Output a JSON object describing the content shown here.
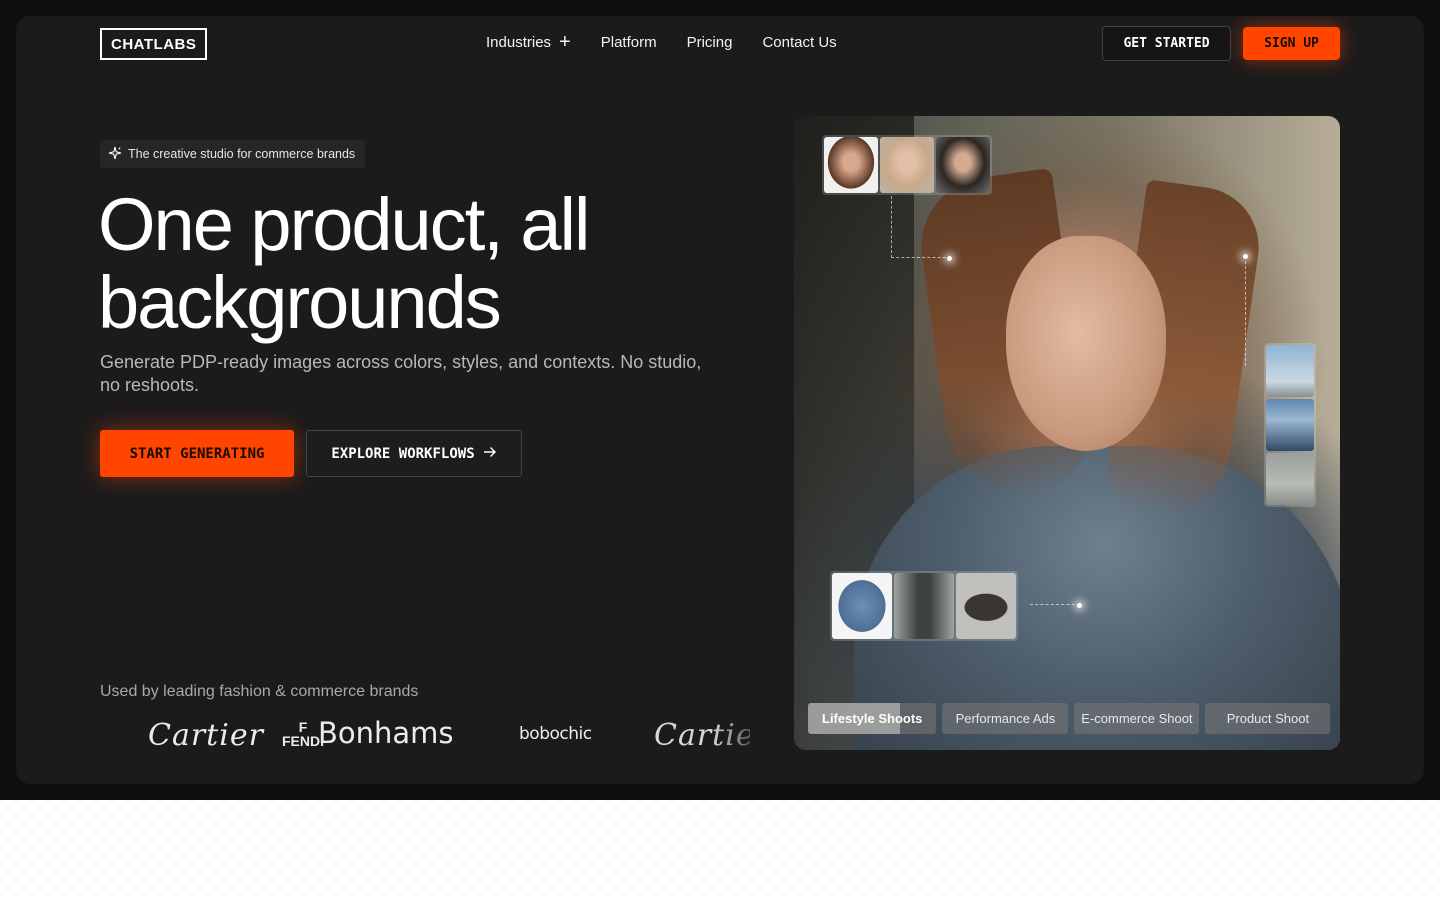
{
  "header": {
    "logo": "CHATLABS",
    "nav": [
      {
        "label": "Industries",
        "has_plus": true
      },
      {
        "label": "Platform"
      },
      {
        "label": "Pricing"
      },
      {
        "label": "Contact Us"
      }
    ],
    "get_started_label": "GET STARTED",
    "sign_up_label": "SIGN UP"
  },
  "hero": {
    "badge": "The creative studio for commerce brands",
    "headline_line1": "One product, all",
    "headline_line2": "backgrounds",
    "subtitle": "Generate PDP-ready images across colors, styles, and contexts. No studio, no reshoots.",
    "cta_primary": "START GENERATING",
    "cta_secondary": "EXPLORE WORKFLOWS",
    "tabs": [
      "Lifestyle Shoots",
      "Performance Ads",
      "E-commerce Shoot",
      "Product Shoot"
    ],
    "active_tab": "Lifestyle Shoots"
  },
  "brands": {
    "caption": "Used by leading fashion & commerce brands",
    "logos": [
      "Cartier",
      "FENDI",
      "Bonhams",
      "bobochic",
      "Cartier"
    ]
  },
  "colors": {
    "accent": "#ff4500",
    "panel": "#1b1b1b",
    "page_bg": "#0e0e0e"
  },
  "icons": {
    "badge": "sparkle-icon",
    "industries": "plus-icon",
    "explore": "arrow-right-icon"
  }
}
